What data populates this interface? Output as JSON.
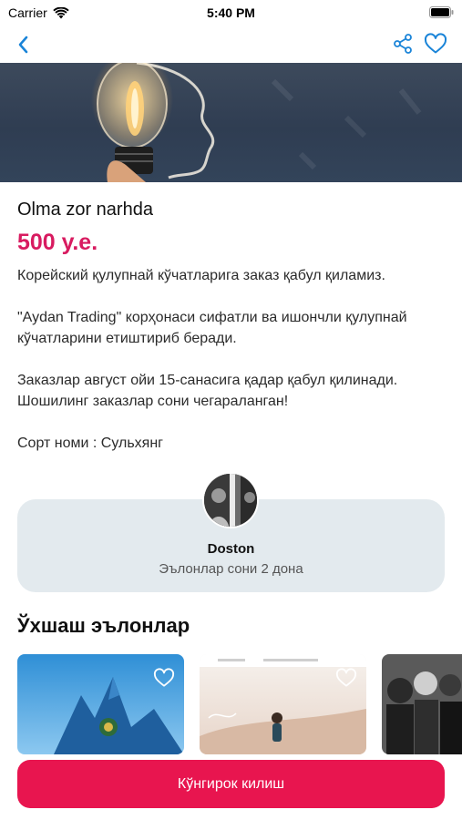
{
  "status_bar": {
    "carrier": "Carrier",
    "time": "5:40 PM"
  },
  "nav": {
    "back_icon": "chevron-left-icon",
    "share_icon": "share-icon",
    "favorite_icon": "heart-outline-icon",
    "accent_color": "#1a84d8"
  },
  "listing": {
    "title": "Olma zor narhda",
    "price": "500 у.е.",
    "price_color": "#d81b60",
    "description": [
      "Корейский қулупнай кўчатларига заказ қабул қиламиз.",
      "\"Aydan Trading\" корҳонаси сифатли ва ишончли қулупнай кўчатларини етиштириб беради.",
      "Заказлар август ойи 15-санасига қадар қабул қилинади. Шошилинг заказлар сони чегараланган!",
      "Сорт номи : Сульхянг"
    ]
  },
  "seller": {
    "name": "Doston",
    "listings_count": "Эълонлар сони 2 дона"
  },
  "similar": {
    "heading": "Ўхшаш эълонлар",
    "items": [
      {
        "favorite_icon": "heart-outline-icon"
      },
      {
        "favorite_icon": "heart-outline-icon"
      },
      {
        "favorite_icon": "heart-outline-icon"
      }
    ]
  },
  "call_button": {
    "label": "Кўнгирок килиш",
    "color": "#e8154f"
  }
}
